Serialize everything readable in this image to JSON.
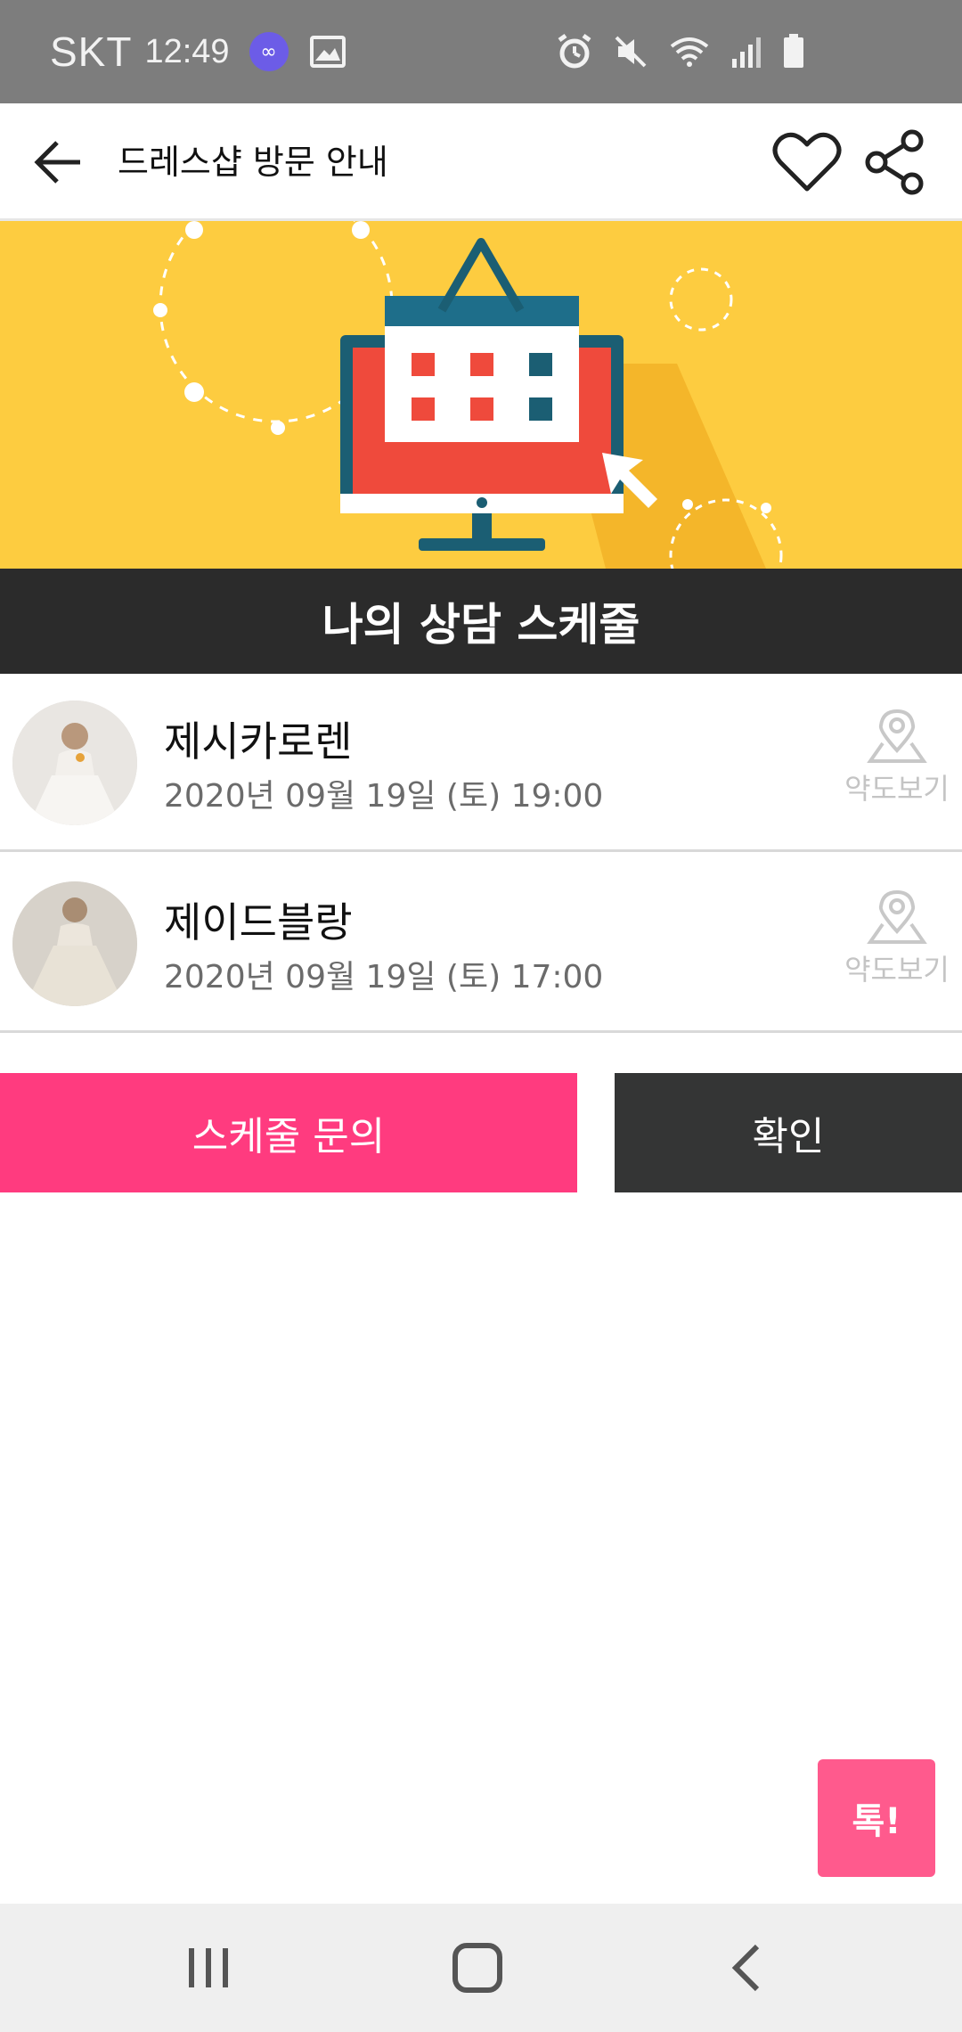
{
  "status_bar": {
    "carrier": "SKT",
    "time": "12:49"
  },
  "app_bar": {
    "title": "드레스샵 방문 안내"
  },
  "banner": {
    "section_title": "나의 상담 스케줄"
  },
  "schedules": [
    {
      "name": "제시카로렌",
      "datetime": "2020년 09월 19일 (토) 19:00",
      "map_label": "약도보기"
    },
    {
      "name": "제이드블랑",
      "datetime": "2020년 09월 19일 (토) 17:00",
      "map_label": "약도보기"
    }
  ],
  "actions": {
    "inquiry_label": "스케줄 문의",
    "confirm_label": "확인"
  },
  "talk_button": {
    "label": "톡!"
  },
  "colors": {
    "status_bar": "#7d7d7d",
    "banner_bg": "#fdcc40",
    "title_bar": "#2b2b2b",
    "inquiry_button": "#ff3b7f",
    "confirm_button": "#343535",
    "talk_button": "#ff5a8d",
    "nav_bar": "#efefef"
  },
  "icons": {
    "back": "arrow-left-icon",
    "heart": "heart-icon",
    "share": "share-icon",
    "map": "map-pin-icon"
  }
}
